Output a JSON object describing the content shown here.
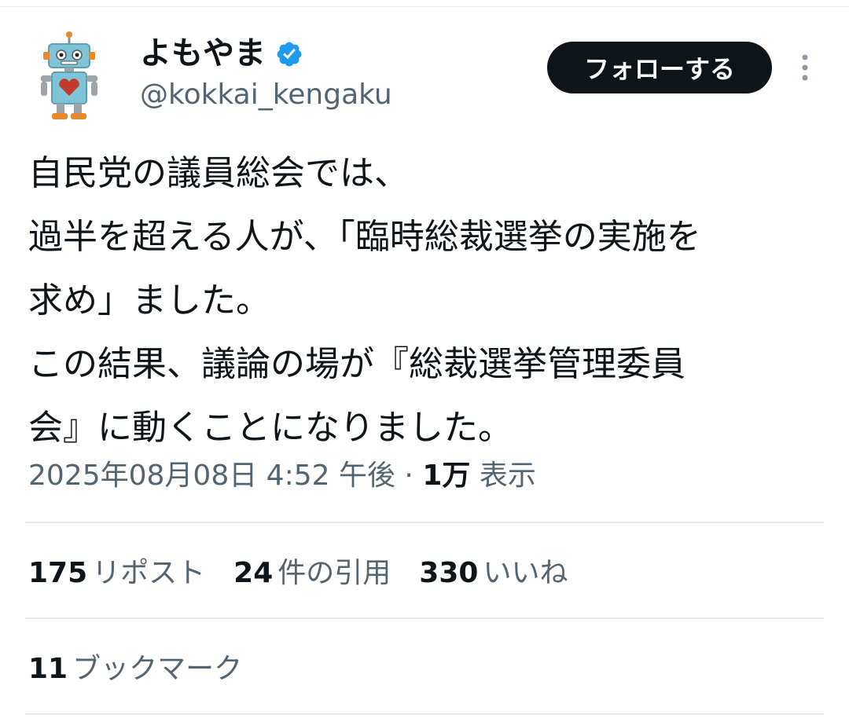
{
  "author": {
    "display_name": "よもやま",
    "handle": "@kokkai_kengaku",
    "avatar_icon": "robot-avatar-icon",
    "verified_icon": "verified-badge-icon"
  },
  "header": {
    "follow_label": "フォローする",
    "more_icon": "more-vertical-icon"
  },
  "tweet": {
    "lines": [
      "自民党の議員総会では、",
      "過半を超える人が、「臨時総裁選挙の実施を",
      "求め」ました。",
      "この結果、議論の場が『総裁選挙管理委員",
      "会』に動くことになりました。"
    ]
  },
  "meta": {
    "date": "2025年08月08日 4:52 午後",
    "separator": "·",
    "views_count": "1万",
    "views_label": "表示"
  },
  "stats": {
    "reposts_count": "175",
    "reposts_label": "リポスト",
    "quotes_count": "24",
    "quotes_label": "件の引用",
    "likes_count": "330",
    "likes_label": "いいね",
    "bookmarks_count": "11",
    "bookmarks_label": "ブックマーク"
  },
  "colors": {
    "text": "#0f1419",
    "secondary_text": "#536471",
    "verified_blue": "#1d9bf0",
    "divider": "#e6e9ec",
    "follow_button_bg": "#0f1419"
  }
}
